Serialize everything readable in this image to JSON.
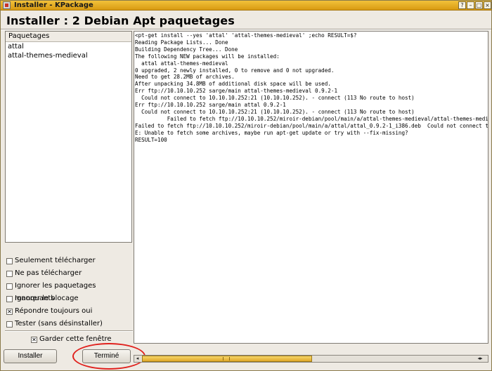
{
  "window": {
    "title": "Installer - KPackage",
    "buttons": [
      "?",
      "–",
      "□",
      "×"
    ]
  },
  "header": {
    "title": "Installer : 2 Debian Apt paquetages"
  },
  "packages": {
    "column": "Paquetages",
    "items": [
      "attal",
      "attal-themes-medieval"
    ]
  },
  "options": [
    {
      "label": "Seulement télécharger",
      "checked": false
    },
    {
      "label": "Ne pas télécharger",
      "checked": false
    },
    {
      "label": "Ignorer les paquetages manquants",
      "checked": false
    },
    {
      "label": "Ignorer le blocage",
      "checked": false
    },
    {
      "label": "Répondre toujours oui",
      "checked": true
    },
    {
      "label": "Tester (sans désinstaller)",
      "checked": false
    }
  ],
  "keep_window": {
    "label": "Garder cette fenêtre",
    "checked": true
  },
  "buttons": {
    "install": "Installer",
    "done": "Terminé"
  },
  "log_lines": [
    "<pt-get install --yes 'attal' 'attal-themes-medieval' ;echo RESULT=$?",
    "Reading Package Lists... Done",
    "Building Dependency Tree... Done",
    "The following NEW packages will be installed:",
    "  attal attal-themes-medieval",
    "0 upgraded, 2 newly installed, 0 to remove and 0 not upgraded.",
    "Need to get 28.2MB of archives.",
    "After unpacking 34.8MB of additional disk space will be used.",
    "Err ftp://10.10.10.252 sarge/main attal-themes-medieval 0.9.2-1",
    "  Could not connect to 10.10.10.252:21 (10.10.10.252). - connect (113 No route to host)",
    "Err ftp://10.10.10.252 sarge/main attal 0.9.2-1",
    "  Could not connect to 10.10.10.252:21 (10.10.10.252). - connect (113 No route to host)",
    "          Failed to fetch ftp://10.10.10.252/miroir-debian/pool/main/a/attal-themes-medieval/attal-themes-medi",
    "Failed to fetch ftp://10.10.10.252/miroir-debian/pool/main/a/attal/attal_0.9.2-1_i386.deb  Could not connect to",
    "E: Unable to fetch some archives, maybe run apt-get update or try with --fix-missing?",
    "RESULT=100"
  ],
  "scrollbar": {
    "left_arrow": "◂",
    "right_arrows": "◂▸"
  }
}
